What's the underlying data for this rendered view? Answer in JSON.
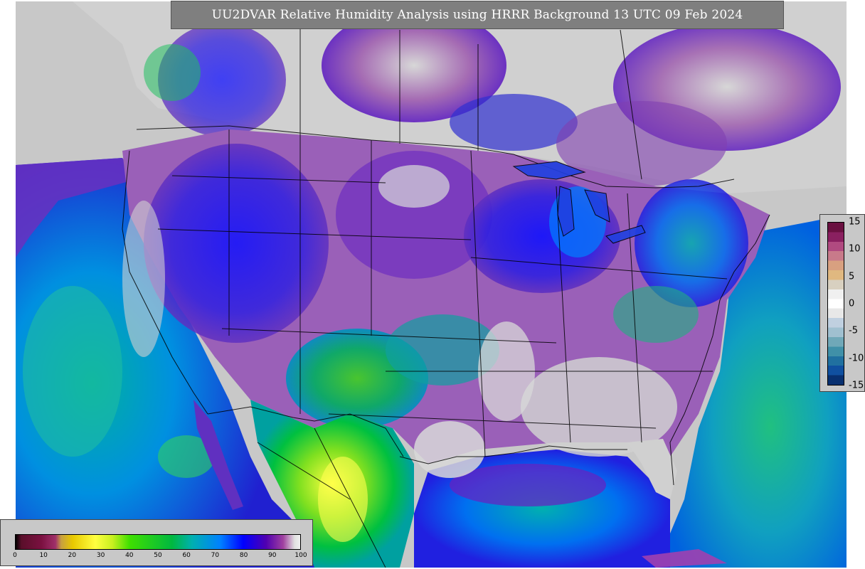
{
  "title": "UU2DVAR Relative Humidity Analysis using HRRR Background 13 UTC 09 Feb 2024",
  "colors": {
    "map_background": "#c8c8c8",
    "title_background": "#7f7f7f",
    "title_text": "#ffffff"
  },
  "humidity_colorbar": {
    "range": [
      0,
      100
    ],
    "tick_labels": [
      "0",
      "10",
      "20",
      "30",
      "40",
      "50",
      "60",
      "70",
      "80",
      "90",
      "100"
    ],
    "stops": [
      {
        "value": 0,
        "color": "#000000"
      },
      {
        "value": 2,
        "color": "#5a0f2a"
      },
      {
        "value": 9,
        "color": "#7a1040"
      },
      {
        "value": 14,
        "color": "#a0306a"
      },
      {
        "value": 16,
        "color": "#c8a040"
      },
      {
        "value": 20,
        "color": "#e8c800"
      },
      {
        "value": 28,
        "color": "#ffff40"
      },
      {
        "value": 34,
        "color": "#c8f020"
      },
      {
        "value": 40,
        "color": "#40e000"
      },
      {
        "value": 55,
        "color": "#00b840"
      },
      {
        "value": 62,
        "color": "#00b0b0"
      },
      {
        "value": 72,
        "color": "#0080ff"
      },
      {
        "value": 80,
        "color": "#0000ff"
      },
      {
        "value": 88,
        "color": "#5000b0"
      },
      {
        "value": 94,
        "color": "#a040a0"
      },
      {
        "value": 98,
        "color": "#e0e0e0"
      },
      {
        "value": 100,
        "color": "#f0f0f0"
      }
    ]
  },
  "difference_colorbar": {
    "range": [
      -15,
      15
    ],
    "tick_labels": [
      "15",
      "10",
      "5",
      "0",
      "-5",
      "-10",
      "-15"
    ],
    "colors_top_to_bottom": [
      "#6a1040",
      "#8a2060",
      "#b04a80",
      "#c87a8a",
      "#d8a080",
      "#e0b880",
      "#d8d0c0",
      "#f0f0f0",
      "#ffffff",
      "#e8e8e8",
      "#c0d0e0",
      "#a0c0d0",
      "#70a8b8",
      "#4090a8",
      "#2070a0",
      "#1050a0",
      "#083070"
    ]
  }
}
